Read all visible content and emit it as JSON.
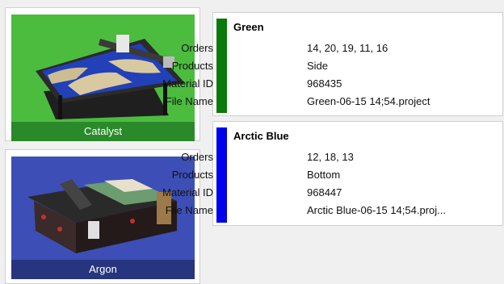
{
  "machines": [
    {
      "name": "Catalyst",
      "bg_color": "#4cbc3f",
      "caption_color": "#2a8a2a"
    },
    {
      "name": "Argon",
      "bg_color": "#3d4fb6",
      "caption_color": "#27357f"
    }
  ],
  "jobs": [
    {
      "title": "Green",
      "color": "#0a7a0a",
      "fields": [
        {
          "label": "Orders",
          "value": "14, 20, 19, 11, 16"
        },
        {
          "label": "Products",
          "value": "Side"
        },
        {
          "label": "Material ID",
          "value": "968435"
        },
        {
          "label": "File Name",
          "value": "Green-06-15 14;54.project"
        }
      ]
    },
    {
      "title": "Arctic Blue",
      "color": "#0000ee",
      "fields": [
        {
          "label": "Orders",
          "value": "12, 18, 13"
        },
        {
          "label": "Products",
          "value": "Bottom"
        },
        {
          "label": "Material ID",
          "value": "968447"
        },
        {
          "label": "File Name",
          "value": "Arctic Blue-06-15 14;54.proj..."
        }
      ]
    }
  ]
}
